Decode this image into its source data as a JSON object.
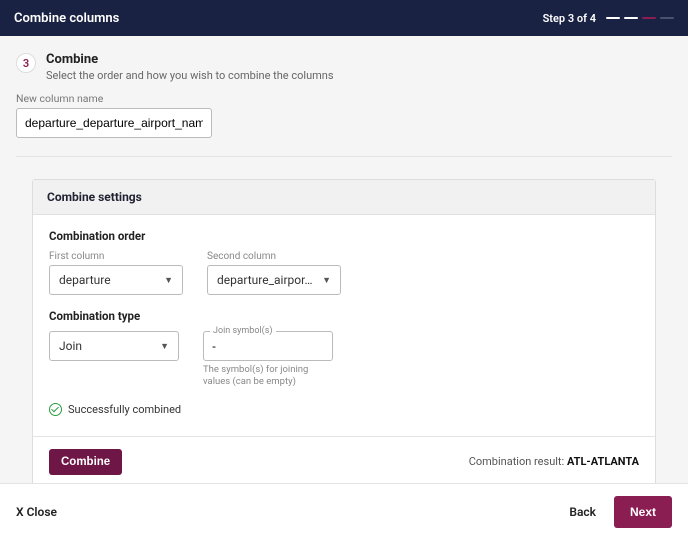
{
  "header": {
    "title": "Combine columns",
    "step_text": "Step 3 of 4",
    "total_steps": 4,
    "current_step": 3
  },
  "wizard": {
    "step_number": "3",
    "title": "Combine",
    "subtitle": "Select the order and how you wish to combine the columns"
  },
  "new_column": {
    "label": "New column name",
    "value": "departure_departure_airport_name"
  },
  "panel": {
    "title": "Combine settings",
    "order_label": "Combination order",
    "first_col_label": "First column",
    "first_col_value": "departure",
    "second_col_label": "Second column",
    "second_col_value": "departure_airpor…",
    "type_label": "Combination type",
    "type_value": "Join",
    "join_symbol_label": "Join symbol(s)",
    "join_symbol_value": "-",
    "join_helper": "The symbol(s) for joining values (can be empty)",
    "success_text": "Successfully combined",
    "combine_btn": "Combine",
    "result_label": "Combination result: ",
    "result_value": "ATL-ATLANTA"
  },
  "footer": {
    "close": "X Close",
    "back": "Back",
    "next": "Next"
  }
}
